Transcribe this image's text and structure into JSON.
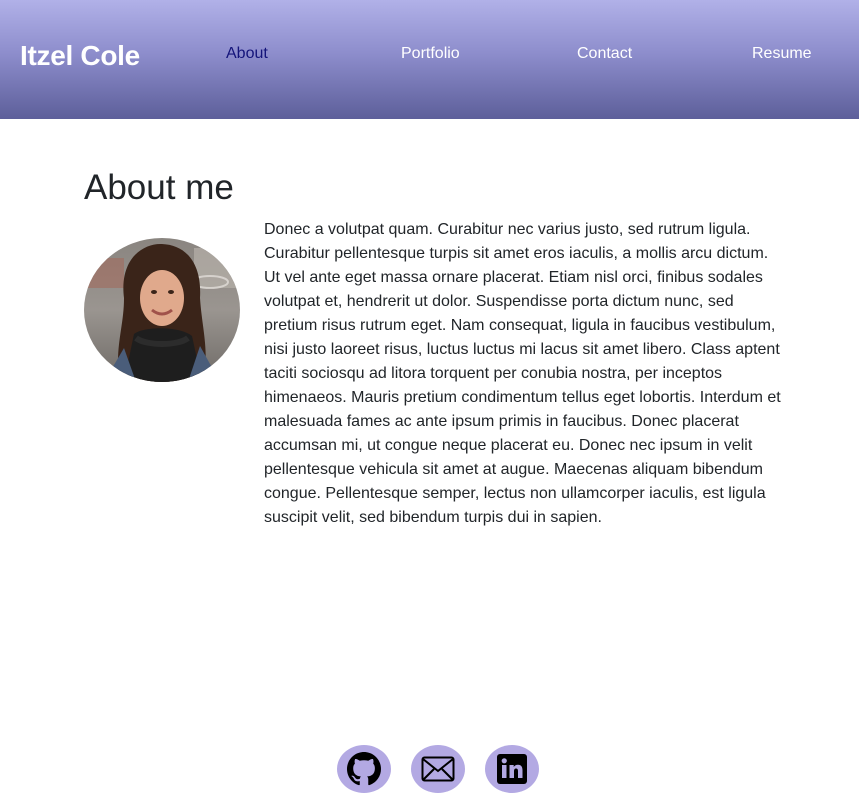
{
  "header": {
    "brand": "Itzel Cole",
    "nav": {
      "about": "About",
      "portfolio": "Portfolio",
      "contact": "Contact",
      "resume": "Resume"
    },
    "active_color": "#14147a"
  },
  "main": {
    "title": "About me",
    "bio": "Donec a volutpat quam. Curabitur nec varius justo, sed rutrum ligula. Curabitur pellentesque turpis sit amet eros iaculis, a mollis arcu dictum. Ut vel ante eget massa ornare placerat. Etiam nisl orci, finibus sodales volutpat et, hendrerit ut dolor. Suspendisse porta dictum nunc, sed pretium risus rutrum eget. Nam consequat, ligula in faucibus vestibulum, nisi justo laoreet risus, luctus luctus mi lacus sit amet libero. Class aptent taciti sociosqu ad litora torquent per conubia nostra, per inceptos himenaeos. Mauris pretium condimentum tellus eget lobortis. Interdum et malesuada fames ac ante ipsum primis in faucibus. Donec placerat accumsan mi, ut congue neque placerat eu. Donec nec ipsum in velit pellentesque vehicula sit amet at augue. Maecenas aliquam bibendum congue. Pellentesque semper, lectus non ullamcorper iaculis, est ligula suscipit velit, sed bibendum turpis dui in sapien."
  },
  "footer": {
    "social_icons": [
      "github-icon",
      "mail-icon",
      "linkedin-icon"
    ],
    "icon_bg_color": "#b3a9e3"
  }
}
